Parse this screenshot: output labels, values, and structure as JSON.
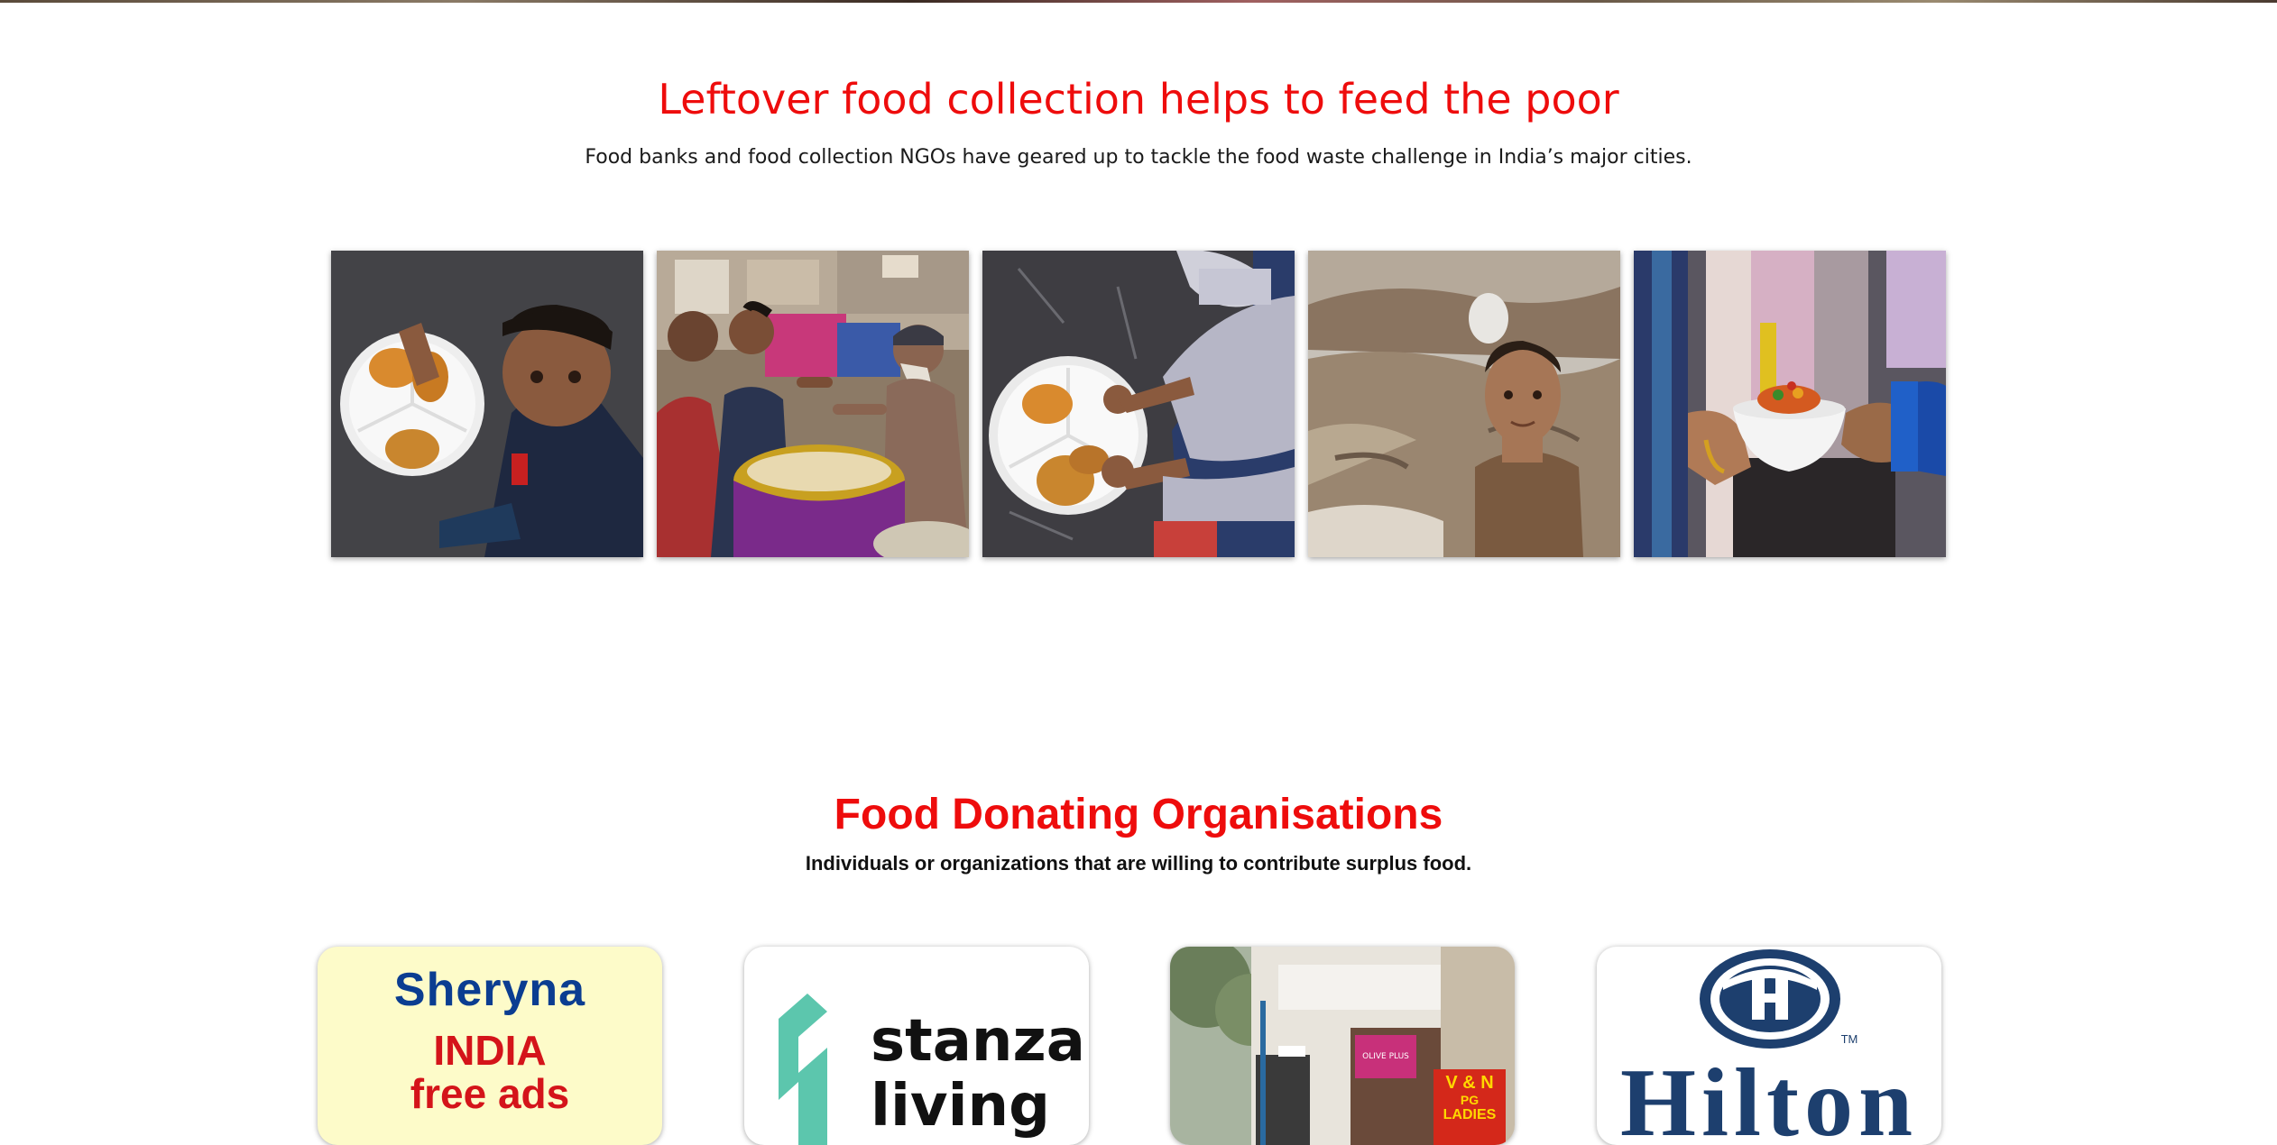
{
  "leftover_section": {
    "title": "Leftover food collection helps to feed the poor",
    "subtitle": "Food banks and food collection NGOs have geared up to tackle the food waste challenge in India’s major cities.",
    "photos": [
      {
        "icon": "child-with-plate-photo"
      },
      {
        "icon": "men-sharing-food-photo"
      },
      {
        "icon": "child-eating-flatbread-photo"
      },
      {
        "icon": "boy-on-dirt-photo"
      },
      {
        "icon": "hands-passing-bowl-photo"
      }
    ]
  },
  "donors_section": {
    "title": "Food Donating Organisations",
    "subtitle": "Individuals or organizations that are willing to contribute surplus food.",
    "orgs": [
      {
        "line1": "Sheryna",
        "line2": "INDIA",
        "line3": "free ads"
      },
      {
        "name_line1": "stanza",
        "name_line2": "living"
      },
      {
        "sign1": "OLIVE PLUS",
        "sign2": "V & N",
        "sign3": "PG",
        "sign4": "LADIES"
      },
      {
        "wordmark": "Hilton",
        "tm": "TM"
      }
    ]
  },
  "colors": {
    "heading_red": "#ee0c0c",
    "sheryna_bg": "#fdfbc9",
    "sheryna_blue": "#0b3d91",
    "sheryna_red": "#d4141a",
    "stanza_teal": "#5cc6ad",
    "hilton_navy": "#1d3f6e"
  }
}
